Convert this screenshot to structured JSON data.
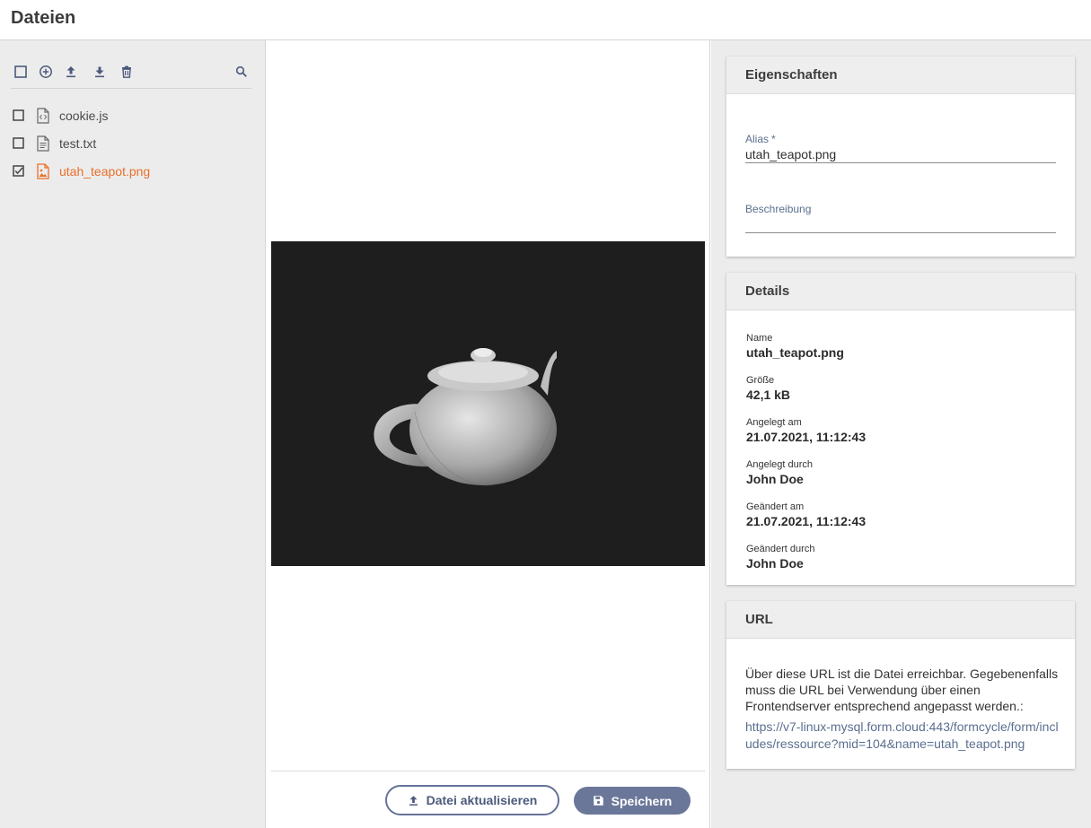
{
  "header": {
    "title": "Dateien"
  },
  "files": [
    {
      "name": "cookie.js",
      "icon": "js-file-icon",
      "checked": false,
      "active": false
    },
    {
      "name": "test.txt",
      "icon": "text-file-icon",
      "checked": false,
      "active": false
    },
    {
      "name": "utah_teapot.png",
      "icon": "image-file-icon",
      "checked": true,
      "active": true
    }
  ],
  "colors": {
    "accent": "#ea6f2a",
    "primary": "#6a7799",
    "link": "#5b6f8f"
  },
  "preview": {
    "update_label": "Datei aktualisieren",
    "save_label": "Speichern"
  },
  "properties": {
    "title": "Eigenschaften",
    "alias_label": "Alias",
    "alias_required": "*",
    "alias_value": "utah_teapot.png",
    "description_label": "Beschreibung",
    "description_value": ""
  },
  "details": {
    "title": "Details",
    "items": [
      {
        "label": "Name",
        "value": "utah_teapot.png"
      },
      {
        "label": "Größe",
        "value": "42,1 kB"
      },
      {
        "label": "Angelegt am",
        "value": "21.07.2021, 11:12:43"
      },
      {
        "label": "Angelegt durch",
        "value": "John Doe"
      },
      {
        "label": "Geändert am",
        "value": "21.07.2021, 11:12:43"
      },
      {
        "label": "Geändert durch",
        "value": "John Doe"
      }
    ]
  },
  "url": {
    "title": "URL",
    "text": "Über diese URL ist die Datei erreichbar. Gegebenenfalls muss die URL bei Verwendung über einen Frontendserver entsprechend angepasst werden.:",
    "link": "https://v7-linux-mysql.form.cloud:443/formcycle/form/includes/ressource?mid=104&name=utah_teapot.png"
  }
}
